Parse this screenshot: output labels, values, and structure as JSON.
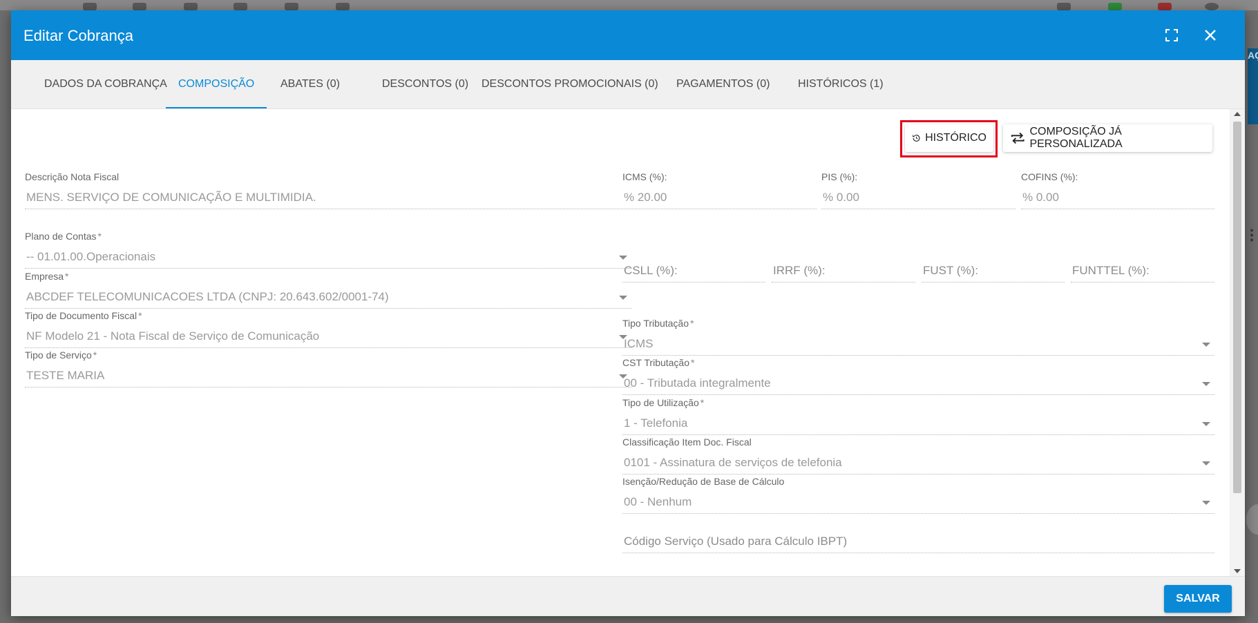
{
  "dialog": {
    "title": "Editar Cobrança",
    "save_label": "SALVAR"
  },
  "tabs": [
    {
      "label": "DADOS DA COBRANÇA",
      "active": false
    },
    {
      "label": "COMPOSIÇÃO",
      "active": true
    },
    {
      "label": "ABATES (0)",
      "active": false
    },
    {
      "label": "DESCONTOS (0)",
      "active": false
    },
    {
      "label": "DESCONTOS PROMOCIONAIS (0)",
      "active": false
    },
    {
      "label": "PAGAMENTOS (0)",
      "active": false
    },
    {
      "label": "HISTÓRICOS (1)",
      "active": false
    }
  ],
  "actions": {
    "historico_label": "HISTÓRICO",
    "composicao_label": "COMPOSIÇÃO JÁ PERSONALIZADA"
  },
  "left_fields": {
    "descricao": {
      "label": "Descrição Nota Fiscal",
      "value": "MENS. SERVIÇO DE COMUNICAÇÃO E MULTIMIDIA."
    },
    "plano": {
      "label": "Plano de Contas",
      "value": "-- 01.01.00.Operacionais"
    },
    "empresa": {
      "label": "Empresa",
      "value": "ABCDEF TELECOMUNICACOES LTDA (CNPJ: 20.643.602/0001-74)"
    },
    "tipo_doc": {
      "label": "Tipo de Documento Fiscal",
      "value": "NF Modelo 21 - Nota Fiscal de Serviço de Comunicação"
    },
    "tipo_servico": {
      "label": "Tipo de Serviço",
      "value": "TESTE MARIA"
    }
  },
  "taxes": {
    "icms": {
      "label": "ICMS (%):",
      "value": "% 20.00"
    },
    "pis": {
      "label": "PIS (%):",
      "value": "% 0.00"
    },
    "cofins": {
      "label": "COFINS (%):",
      "value": "% 0.00"
    },
    "csll": "CSLL (%):",
    "irrf": "IRRF (%):",
    "fust": "FUST (%):",
    "funttel": "FUNTTEL (%):"
  },
  "right_fields": {
    "tipo_trib": {
      "label": "Tipo Tributação",
      "value": "ICMS"
    },
    "cst": {
      "label": "CST Tributação",
      "value": "00 - Tributada integralmente"
    },
    "utilizacao": {
      "label": "Tipo de Utilização",
      "value": "1 - Telefonia"
    },
    "classificacao": {
      "label": "Classificação Item Doc. Fiscal",
      "value": "0101 - Assinatura de serviços de telefonia"
    },
    "isencao": {
      "label": "Isenção/Redução de Base de Cálculo",
      "value": "00 - Nenhum"
    },
    "codigo_servico": "Código Serviço (Usado para Cálculo IBPT)"
  },
  "required_mark": "*",
  "background": {
    "side_text": "AÇ"
  },
  "colors": {
    "accent": "#0a89d6",
    "highlight": "#e3001b"
  }
}
